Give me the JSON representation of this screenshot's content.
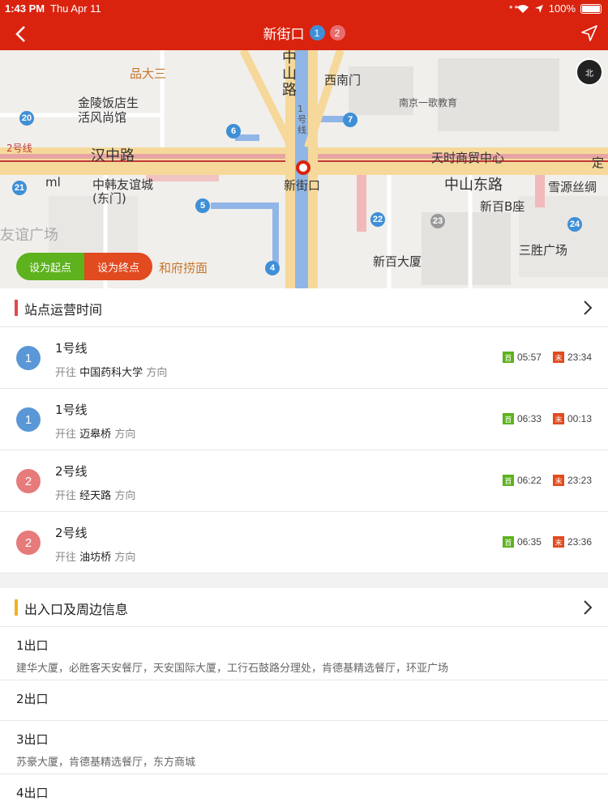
{
  "status": {
    "time": "1:43 PM",
    "date": "Thu Apr 11",
    "battery": "100%"
  },
  "header": {
    "title": "新街口",
    "badges": [
      "1",
      "2"
    ]
  },
  "map": {
    "labels": {
      "pindasan": "品大三",
      "zhongshan": "中\n山\n路",
      "xinanmen": "西南门",
      "jinling": "金陵饭店生\n活风尚馆",
      "nanjing_edu": "南京一歌教育",
      "hanzhong": "汉中路",
      "line2": "2号线",
      "tianshi": "天时商贸中心",
      "ding": "定",
      "zhonghan": "中韩友谊城\n(东门)",
      "ml": "ml",
      "xinjiekou": "新街口",
      "zhongshandong": "中山东路",
      "xueyuan": "雪源丝绸",
      "xinbai_b": "新百B座",
      "youyi": "友谊广场",
      "sansheng": "三胜广场",
      "haidilao": "和府捞面",
      "xinbai": "新百大厦",
      "line1": "1\n号\n线"
    },
    "exits": [
      "20",
      "6",
      "7",
      "21",
      "5",
      "4",
      "22",
      "23",
      "24"
    ],
    "compass": "北",
    "set_start": "设为起点",
    "set_end": "设为终点"
  },
  "operations": {
    "title": "站点运营时间",
    "toward": "开往",
    "direction": "方向",
    "first_tag": "首",
    "last_tag": "末",
    "lines": [
      {
        "num": "1",
        "name": "1号线",
        "dest": "中国药科大学",
        "first": "05:57",
        "last": "23:34",
        "color": "#3f8fd6"
      },
      {
        "num": "1",
        "name": "1号线",
        "dest": "迈皋桥",
        "first": "06:33",
        "last": "00:13",
        "color": "#3f8fd6"
      },
      {
        "num": "2",
        "name": "2号线",
        "dest": "经天路",
        "first": "06:22",
        "last": "23:23",
        "color": "#e96d6d"
      },
      {
        "num": "2",
        "name": "2号线",
        "dest": "油坊桥",
        "first": "06:35",
        "last": "23:36",
        "color": "#e96d6d"
      }
    ]
  },
  "exits_section": {
    "title": "出入口及周边信息",
    "items": [
      {
        "name": "1出口",
        "desc": "建华大厦，必胜客天安餐厅，天安国际大厦，工行石鼓路分理处，肯德基精选餐厅，环亚广场"
      },
      {
        "name": "2出口",
        "desc": ""
      },
      {
        "name": "3出口",
        "desc": "苏豪大厦，肯德基精选餐厅，东方商城"
      },
      {
        "name": "4出口",
        "desc": ""
      }
    ]
  }
}
